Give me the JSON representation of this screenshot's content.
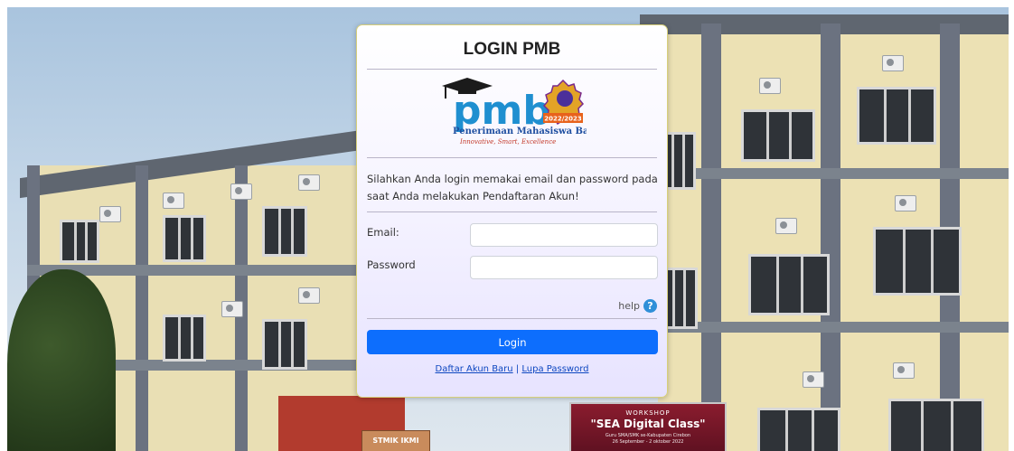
{
  "login": {
    "title": "LOGIN PMB",
    "logo": {
      "wordmark": "pmb",
      "year": "2022/2023",
      "subtitle": "Penerimaan Mahasiswa Baru",
      "tagline": "Innovative, Smart, Excellence"
    },
    "intro": "Silahkan Anda login memakai email dan password pada saat Anda melakukan Pendaftaran Akun!",
    "email_label": "Email:",
    "email_value": "",
    "password_label": "Password",
    "password_value": "",
    "help_label": "help",
    "submit_label": "Login",
    "register_link": "Daftar Akun Baru",
    "separator": "|",
    "forgot_link": "Lupa Password"
  },
  "background": {
    "banner_small": "WORKSHOP",
    "banner_title": "\"SEA Digital Class\"",
    "banner_sub": "Guru SMA/SMK se-Kabupaten Cirebon",
    "banner_date": "26 September - 2 oktober 2022",
    "sign_text": "STMIK IKMI"
  },
  "colors": {
    "button": "#0d6efd",
    "link": "#0d47c0",
    "panel_border": "#d7cf7a",
    "help_icon": "#2f8fd8"
  }
}
